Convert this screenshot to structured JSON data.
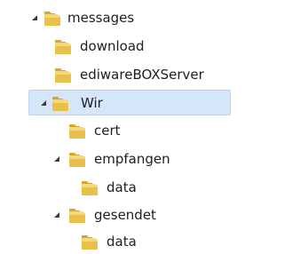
{
  "tree": {
    "items": [
      {
        "label": "messages",
        "expanded": true,
        "icon": "folder-icon"
      },
      {
        "label": "download",
        "expanded": false,
        "icon": "folder-icon"
      },
      {
        "label": "ediwareBOXServer",
        "expanded": false,
        "icon": "folder-icon"
      },
      {
        "label": "Wir",
        "expanded": true,
        "selected": true,
        "icon": "folder-icon"
      },
      {
        "label": "cert",
        "expanded": false,
        "icon": "folder-icon"
      },
      {
        "label": "empfangen",
        "expanded": true,
        "icon": "folder-icon"
      },
      {
        "label": "data",
        "expanded": false,
        "icon": "folder-icon"
      },
      {
        "label": "gesendet",
        "expanded": true,
        "icon": "folder-icon"
      },
      {
        "label": "data",
        "expanded": false,
        "icon": "folder-icon"
      }
    ],
    "colors": {
      "selection_bg": "#d5e6f8",
      "selection_border": "#b7d2ee",
      "folder_body": "#e8c04a",
      "folder_tab": "#d9a72a",
      "expander": "#3c3c3c"
    }
  }
}
